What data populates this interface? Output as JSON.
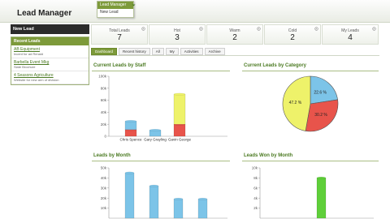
{
  "app": {
    "title": "Lead Manager"
  },
  "dropdown": {
    "items": [
      "Lead Manager",
      "New Lead"
    ]
  },
  "sidebar": {
    "new_lead_label": "New Lead",
    "recent_header": "Recent Leads",
    "recent": [
      {
        "title": "AB Equipment",
        "subtitle": "Incent for ad Renald"
      },
      {
        "title": "Barbella Event Mkg",
        "subtitle": "Slate Brochure"
      },
      {
        "title": "4 Seasons Agriculture",
        "subtitle": "Website for new arm of division"
      }
    ]
  },
  "stats": [
    {
      "label": "Total Leads",
      "value": "7"
    },
    {
      "label": "Hot",
      "value": "3"
    },
    {
      "label": "Warm",
      "value": "2"
    },
    {
      "label": "Cold",
      "value": "2"
    },
    {
      "label": "My Leads",
      "value": "4"
    }
  ],
  "tabs": [
    "Dashboard",
    "Recent history",
    "All",
    "My",
    "Activities",
    "Archive"
  ],
  "colors": {
    "accent": "#7d9a3a",
    "blue": "#7cc4e8",
    "red": "#e8544b",
    "yellow": "#eef26a",
    "green": "#5fcf3a"
  },
  "chart_data": [
    {
      "type": "bar",
      "title": "Current Leads by Staff",
      "categories": [
        "Chris Spence",
        "Gary Grayling",
        "Gavin George"
      ],
      "yticks": [
        "0",
        "20k",
        "40k",
        "60k",
        "80k",
        "100k"
      ],
      "ylim": [
        0,
        100000
      ],
      "stacked": true,
      "series": [
        {
          "color": "#e8544b",
          "values": [
            11000,
            0,
            20000
          ]
        },
        {
          "color": "#7cc4e8",
          "values": [
            14000,
            10000,
            0
          ]
        },
        {
          "color": "#eef26a",
          "values": [
            0,
            0,
            50000
          ]
        }
      ]
    },
    {
      "type": "pie",
      "title": "Current Leads by Category",
      "slices": [
        {
          "label": "22.6 %",
          "value": 22.6,
          "color": "#7cc4e8"
        },
        {
          "label": "30.2 %",
          "value": 30.2,
          "color": "#e8544b"
        },
        {
          "label": "47.2 %",
          "value": 47.2,
          "color": "#eef26a"
        }
      ]
    },
    {
      "type": "bar",
      "title": "Leads by Month",
      "yticks": [
        "10k",
        "20k",
        "30k",
        "40k",
        "50k"
      ],
      "ylim": [
        0,
        50000
      ],
      "values": [
        45000,
        32000,
        19000,
        19000
      ],
      "color": "#7cc4e8"
    },
    {
      "type": "bar",
      "title": "Leads Won by Month",
      "yticks": [
        "2k",
        "4k",
        "6k",
        "8k",
        "10k"
      ],
      "ylim": [
        0,
        10000
      ],
      "values": [
        0,
        0,
        8000
      ],
      "color": "#5fcf3a"
    }
  ]
}
